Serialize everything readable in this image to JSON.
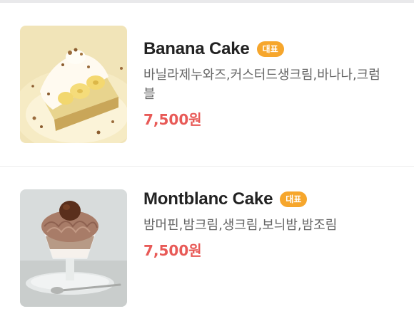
{
  "menu": {
    "items": [
      {
        "name": "Banana Cake",
        "badge": "대표",
        "description": "바닐라제누와즈,커스터드생크림,바나나,크럼블",
        "price": "7,500원",
        "image_icon": "banana-cake-photo"
      },
      {
        "name": "Montblanc Cake",
        "badge": "대표",
        "description": "밤머핀,밤크림,생크림,보늬밤,밤조림",
        "price": "7,500원",
        "image_icon": "montblanc-cake-photo"
      }
    ]
  },
  "colors": {
    "badge": "#f6a62c",
    "price": "#e85a57",
    "divider": "#ececec"
  }
}
